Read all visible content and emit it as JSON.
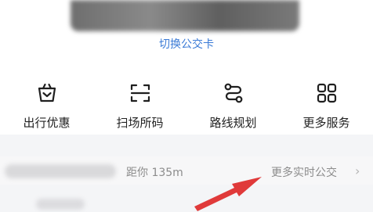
{
  "card": {
    "switch_label": "切换公交卡"
  },
  "quick_actions": [
    {
      "label": "出行优惠",
      "icon": "basket-icon"
    },
    {
      "label": "扫场所码",
      "icon": "scan-frame-icon"
    },
    {
      "label": "路线规划",
      "icon": "route-icon"
    },
    {
      "label": "更多服务",
      "icon": "grid-icon"
    }
  ],
  "nearby_bus": {
    "distance": "距你 135m",
    "more_label": "更多实时公交",
    "chevron": "›"
  },
  "colors": {
    "accent": "#3b7bd6",
    "annotation_arrow": "#e03a3a"
  }
}
